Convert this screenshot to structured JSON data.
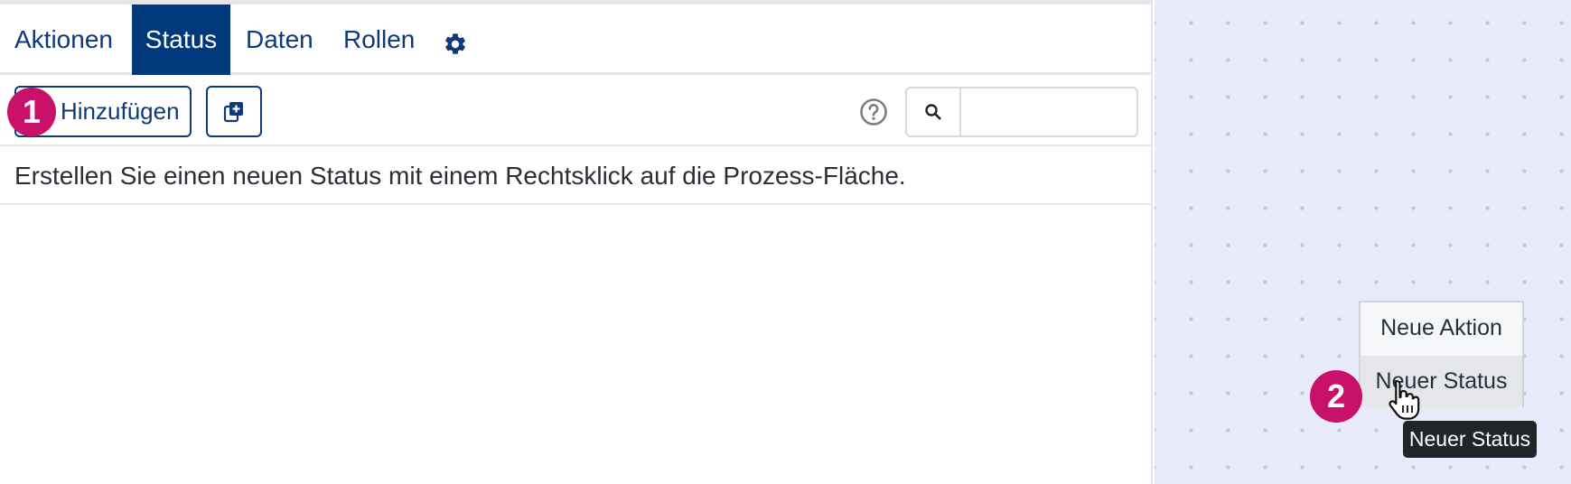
{
  "tabs": [
    {
      "label": "Aktionen",
      "active": false
    },
    {
      "label": "Status",
      "active": true
    },
    {
      "label": "Daten",
      "active": false
    },
    {
      "label": "Rollen",
      "active": false
    }
  ],
  "settings_icon": "gear-icon",
  "toolbar": {
    "add_label": "Hinzufügen",
    "copy_icon": "add-copy-icon",
    "help_icon": "question-circle-icon",
    "search_icon": "search-icon",
    "search_value": ""
  },
  "info_text": "Erstellen Sie einen neuen Status mit einem Rechtsklick auf die Prozess-Fläche.",
  "context_menu": {
    "items": [
      {
        "label": "Neue Aktion"
      },
      {
        "label": "Neuer Status",
        "hovered": true
      }
    ]
  },
  "tooltip": "Neuer Status",
  "badges": [
    "1",
    "2"
  ],
  "colors": {
    "primary": "#003a7d",
    "badge": "#c9116a",
    "canvas": "#e9ebfb",
    "tooltip": "#212529"
  }
}
